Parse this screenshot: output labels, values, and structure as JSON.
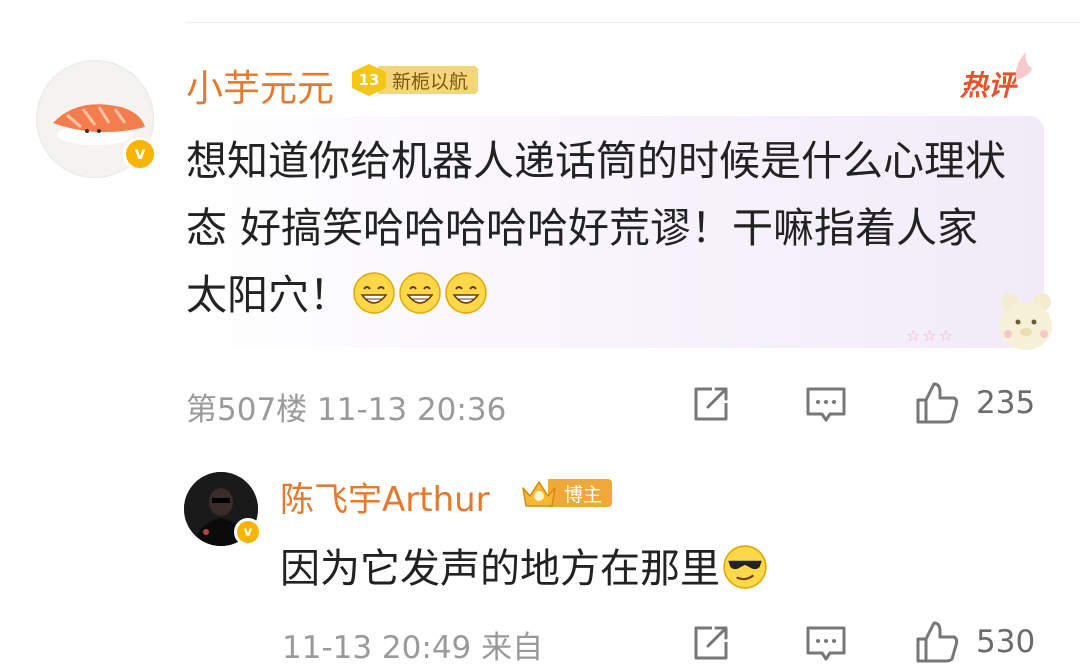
{
  "comment": {
    "username": "小芋元元",
    "fan_badge": {
      "level": "13",
      "label": "新栀以航"
    },
    "hot_label": "热评",
    "text": "想知道你给机器人递话筒的时候是什么心理状态 好搞笑哈哈哈哈哈好荒谬！干嘛指着人家太阳穴！",
    "emoji_icons": [
      "grin-emoji",
      "grin-emoji",
      "grin-emoji"
    ],
    "meta": "第507楼  11-13 20:36",
    "like_count": "235"
  },
  "reply": {
    "username": "陈飞宇Arthur",
    "blogger_badge": "博主",
    "text": "因为它发声的地方在那里",
    "emoji_icon": "sunglasses-emoji",
    "meta": "11-13 20:49  来自",
    "like_count": "530"
  },
  "colors": {
    "name": "#e8792b",
    "verified": "#f7b500",
    "hot": "#e8512b",
    "meta": "#9a9a9a"
  }
}
